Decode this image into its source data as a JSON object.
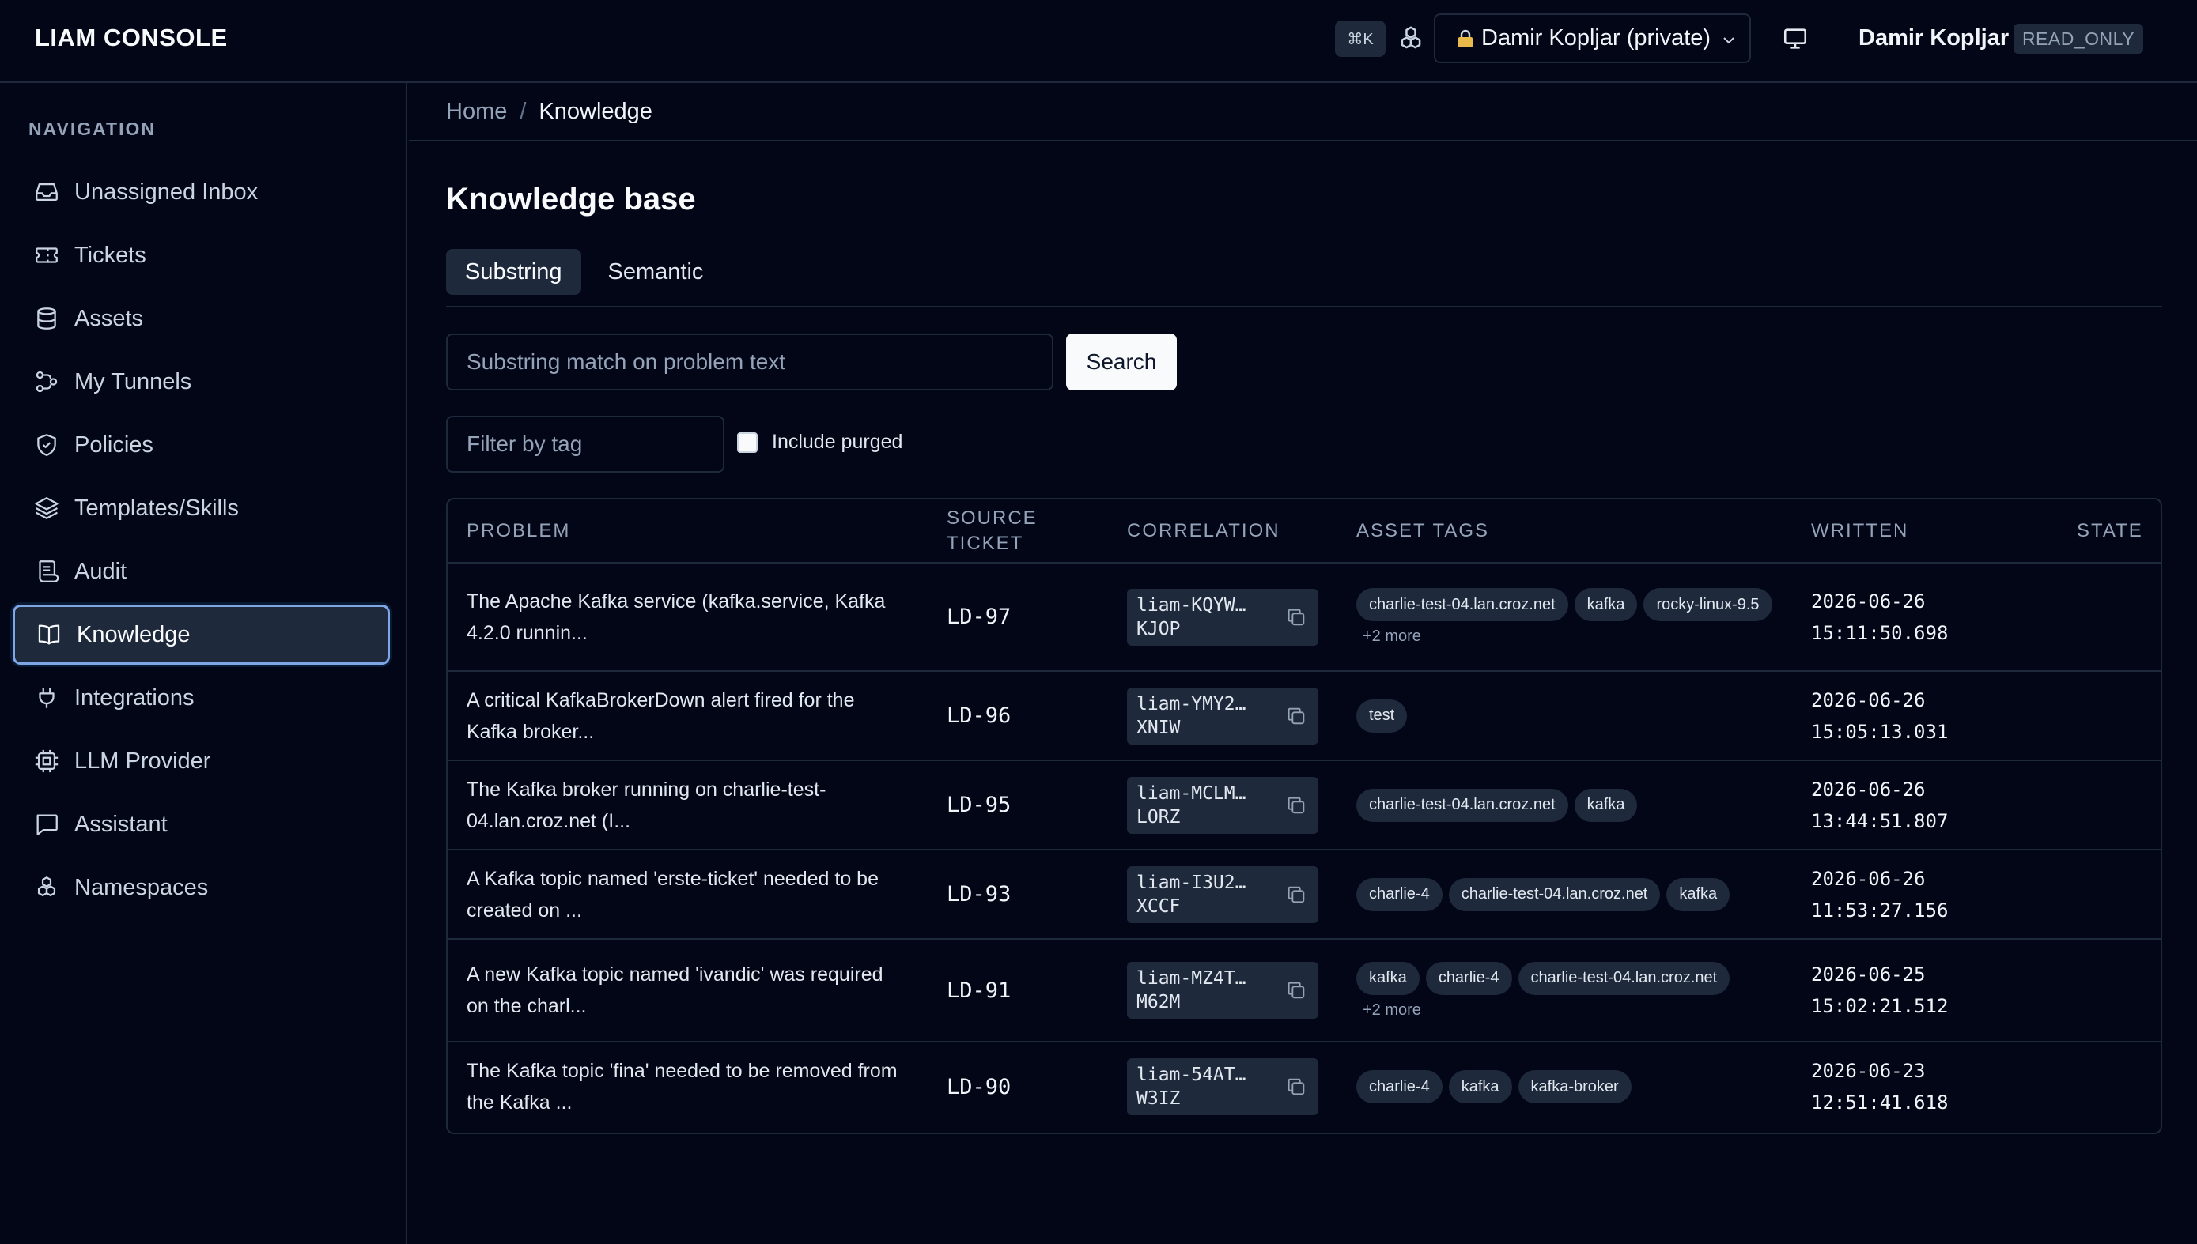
{
  "app": {
    "title": "LIAM CONSOLE",
    "shortcut": "⌘K",
    "namespace": "Damir Kopljar (private)",
    "user": "Damir Kopljar",
    "role": "READ_ONLY"
  },
  "sidebar": {
    "title": "NAVIGATION",
    "items": [
      {
        "label": "Unassigned Inbox",
        "icon": "inbox-icon"
      },
      {
        "label": "Tickets",
        "icon": "ticket-icon"
      },
      {
        "label": "Assets",
        "icon": "database-icon"
      },
      {
        "label": "My Tunnels",
        "icon": "workflow-icon"
      },
      {
        "label": "Policies",
        "icon": "shield-icon"
      },
      {
        "label": "Templates/Skills",
        "icon": "layers-icon"
      },
      {
        "label": "Audit",
        "icon": "scroll-icon"
      },
      {
        "label": "Knowledge",
        "icon": "book-icon",
        "active": true
      },
      {
        "label": "Integrations",
        "icon": "plug-icon"
      },
      {
        "label": "LLM Provider",
        "icon": "cpu-icon"
      },
      {
        "label": "Assistant",
        "icon": "message-icon"
      },
      {
        "label": "Namespaces",
        "icon": "boxes-icon"
      }
    ]
  },
  "breadcrumb": {
    "home": "Home",
    "sep": "/",
    "current": "Knowledge"
  },
  "page": {
    "title": "Knowledge base",
    "tabs": [
      "Substring",
      "Semantic"
    ],
    "active_tab": "Substring",
    "search_placeholder": "Substring match on problem text",
    "search_value": "",
    "search_button": "Search",
    "tag_placeholder": "Filter by tag",
    "include_purged_label": "Include purged",
    "include_purged": false
  },
  "table": {
    "columns": [
      "PROBLEM",
      "SOURCE TICKET",
      "CORRELATION",
      "ASSET TAGS",
      "WRITTEN",
      "STATE"
    ],
    "rows": [
      {
        "problem": "The Apache Kafka service (kafka.service, Kafka 4.2.0 runnin...",
        "ticket": "LD-97",
        "corr1": "liam-KQYW…",
        "corr2": "KJOP",
        "tags": [
          "charlie-test-04.lan.croz.net",
          "kafka",
          "rocky-linux-9.5"
        ],
        "more": "+2 more",
        "date": "2026-06-26",
        "time": "15:11:50.698"
      },
      {
        "problem": "A critical KafkaBrokerDown alert fired for the Kafka broker...",
        "ticket": "LD-96",
        "corr1": "liam-YMY2…",
        "corr2": "XNIW",
        "tags": [
          "test"
        ],
        "more": "",
        "date": "2026-06-26",
        "time": "15:05:13.031"
      },
      {
        "problem": "The Kafka broker running on charlie-test-04.lan.croz.net (I...",
        "ticket": "LD-95",
        "corr1": "liam-MCLM…",
        "corr2": "LORZ",
        "tags": [
          "charlie-test-04.lan.croz.net",
          "kafka"
        ],
        "more": "",
        "date": "2026-06-26",
        "time": "13:44:51.807"
      },
      {
        "problem": "A Kafka topic named 'erste-ticket' needed to be created on ...",
        "ticket": "LD-93",
        "corr1": "liam-I3U2…",
        "corr2": "XCCF",
        "tags": [
          "charlie-4",
          "charlie-test-04.lan.croz.net",
          "kafka"
        ],
        "more": "",
        "date": "2026-06-26",
        "time": "11:53:27.156"
      },
      {
        "problem": "A new Kafka topic named 'ivandic' was required on the charl...",
        "ticket": "LD-91",
        "corr1": "liam-MZ4T…",
        "corr2": "M62M",
        "tags": [
          "kafka",
          "charlie-4",
          "charlie-test-04.lan.croz.net"
        ],
        "more": "+2 more",
        "date": "2026-06-25",
        "time": "15:02:21.512"
      },
      {
        "problem": "The Kafka topic 'fina' needed to be removed from the Kafka ...",
        "ticket": "LD-90",
        "corr1": "liam-54AT…",
        "corr2": "W3IZ",
        "tags": [
          "charlie-4",
          "kafka",
          "kafka-broker"
        ],
        "more": "",
        "date": "2026-06-23",
        "time": "12:51:41.618"
      }
    ]
  }
}
